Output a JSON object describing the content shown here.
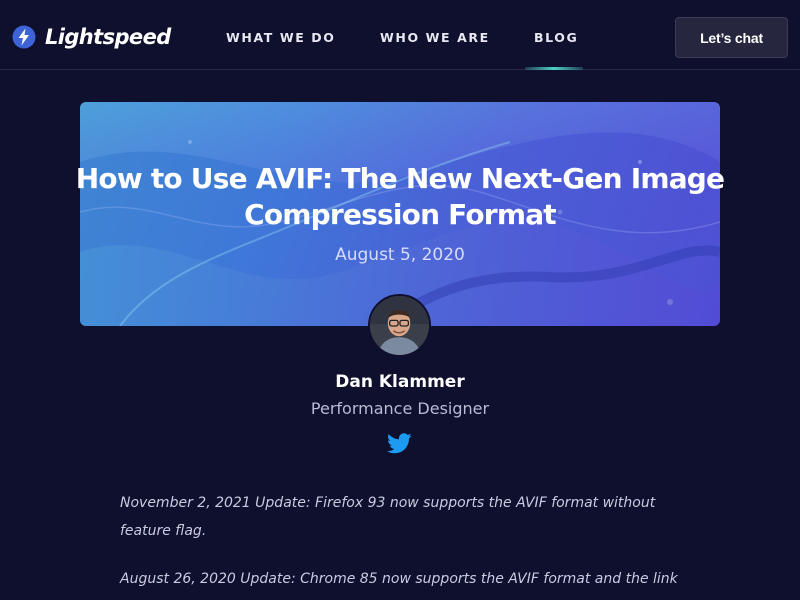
{
  "header": {
    "logo_text": "Lightspeed",
    "logo_icon": "lightning-bolt-icon",
    "nav": [
      {
        "label": "WHAT WE DO"
      },
      {
        "label": "WHO WE ARE"
      },
      {
        "label": "BLOG",
        "active": true
      }
    ],
    "cta_label": "Let’s chat"
  },
  "hero": {
    "title_line1": "How to Use AVIF: The New Next-Gen Image",
    "title_line2": "Compression Format",
    "date": "August 5, 2020"
  },
  "author": {
    "name": "Dan Klammer",
    "role": "Performance Designer",
    "social_icon": "twitter-icon"
  },
  "article": {
    "updates": [
      "November 2, 2021 Update: Firefox 93 now supports the AVIF format without feature flag.",
      "August 26, 2020 Update: Chrome 85 now supports the AVIF format and the link"
    ]
  },
  "colors": {
    "background": "#0f0f2e",
    "nav_active_underline": "#4fd1c5",
    "hero_gradient_start": "#3f86d3",
    "hero_gradient_end": "#4e4fd4",
    "twitter_blue": "#1d9bf0"
  }
}
